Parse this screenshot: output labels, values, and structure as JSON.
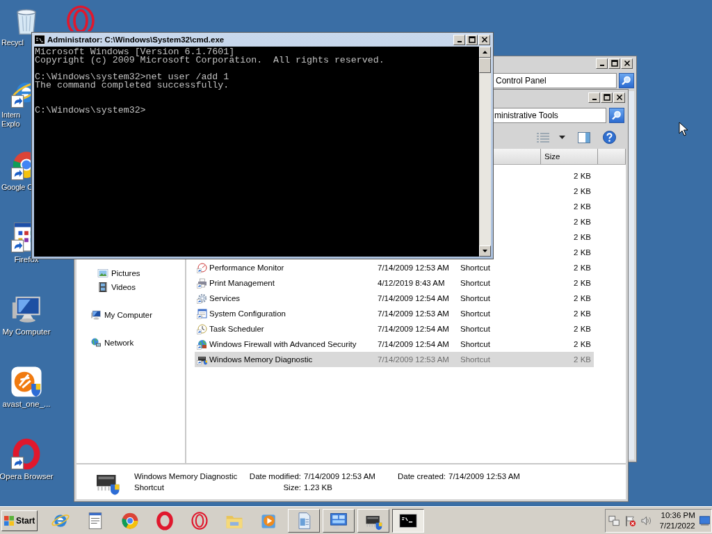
{
  "desktop": {
    "icons": [
      {
        "kind": "recycle",
        "label_lines": [
          "Recycl"
        ],
        "shortcut": false,
        "clipped": true
      },
      {
        "kind": "ie",
        "label_lines": [
          "Intern",
          "Explo"
        ],
        "shortcut": true,
        "clipped": true
      },
      {
        "kind": "chrome",
        "label_lines": [
          "Google C"
        ],
        "shortcut": true,
        "clipped": true
      },
      {
        "kind": "program",
        "label_lines": [
          "Firefox"
        ],
        "shortcut": true,
        "clipped": false
      },
      {
        "kind": "computer",
        "label_lines": [
          "My Computer"
        ],
        "shortcut": false,
        "clipped": false
      },
      {
        "kind": "avast",
        "label_lines": [
          "avast_one_..."
        ],
        "shortcut": false,
        "clipped": false
      },
      {
        "kind": "opera",
        "label_lines": [
          "Opera Browser"
        ],
        "shortcut": true,
        "clipped": false
      }
    ],
    "icon_behind_window": {
      "kind": "opera_gx"
    }
  },
  "control_panel_window": {
    "address": "Control Panel"
  },
  "explorer_window": {
    "address": "ministrative Tools",
    "columns": [
      {
        "label": "Size"
      }
    ],
    "nav": [
      {
        "label": "Pictures",
        "kind": "pictures"
      },
      {
        "label": "Videos",
        "kind": "videos"
      },
      {
        "label": "My Computer",
        "kind": "computer"
      },
      {
        "label": "Network",
        "kind": "network"
      }
    ],
    "rows": [
      {
        "size": "2 KB",
        "selected": false
      },
      {
        "size": "2 KB",
        "selected": false
      },
      {
        "size": "2 KB",
        "selected": false
      },
      {
        "size": "2 KB",
        "selected": false
      },
      {
        "size": "2 KB",
        "selected": false
      },
      {
        "size": "2 KB",
        "selected": false
      },
      {
        "kind": "perfmon",
        "name": "Performance Monitor",
        "date_modified": "7/14/2009 12:53 AM",
        "type": "Shortcut",
        "size": "2 KB",
        "selected": false
      },
      {
        "kind": "printmgmt",
        "name": "Print Management",
        "date_modified": "4/12/2019 8:43 AM",
        "type": "Shortcut",
        "size": "2 KB",
        "selected": false
      },
      {
        "kind": "services",
        "name": "Services",
        "date_modified": "7/14/2009 12:54 AM",
        "type": "Shortcut",
        "size": "2 KB",
        "selected": false
      },
      {
        "kind": "sysconfig",
        "name": "System Configuration",
        "date_modified": "7/14/2009 12:53 AM",
        "type": "Shortcut",
        "size": "2 KB",
        "selected": false
      },
      {
        "kind": "taskscheduler",
        "name": "Task Scheduler",
        "date_modified": "7/14/2009 12:54 AM",
        "type": "Shortcut",
        "size": "2 KB",
        "selected": false
      },
      {
        "kind": "firewall",
        "name": "Windows Firewall with Advanced Security",
        "date_modified": "7/14/2009 12:54 AM",
        "type": "Shortcut",
        "size": "2 KB",
        "selected": false
      },
      {
        "kind": "memdiag",
        "name": "Windows Memory Diagnostic",
        "date_modified": "7/14/2009 12:53 AM",
        "type": "Shortcut",
        "size": "2 KB",
        "selected": true
      }
    ],
    "details": {
      "name": "Windows Memory Diagnostic",
      "type": "Shortcut",
      "fields_row_1": [
        {
          "label": "Date modified:",
          "value": "7/14/2009 12:53 AM"
        },
        {
          "label": "Date created:",
          "value": "7/14/2009 12:53 AM"
        }
      ],
      "fields_row_2": [
        {
          "label": "Size:",
          "value": "1.23 KB"
        }
      ]
    }
  },
  "cmd_window": {
    "title": "Administrator: C:\\Windows\\System32\\cmd.exe",
    "output": "Microsoft Windows [Version 6.1.7601]\nCopyright (c) 2009 Microsoft Corporation.  All rights reserved.\n\nC:\\Windows\\system32>net user /add 1\nThe command completed successfully.\n\n\nC:\\Windows\\system32>"
  },
  "taskbar": {
    "start": "Start",
    "items": [
      {
        "kind": "ie",
        "running": false,
        "active": false
      },
      {
        "kind": "notepad",
        "running": false,
        "active": false
      },
      {
        "kind": "chrome",
        "running": false,
        "active": false
      },
      {
        "kind": "opera",
        "running": false,
        "active": false
      },
      {
        "kind": "opera_gx",
        "running": false,
        "active": false
      },
      {
        "kind": "folder",
        "running": false,
        "active": false
      },
      {
        "kind": "media",
        "running": false,
        "active": false
      },
      {
        "kind": "document",
        "running": true,
        "active": false
      },
      {
        "kind": "controlpanel",
        "running": true,
        "active": false
      },
      {
        "kind": "memdiag",
        "running": true,
        "active": false
      },
      {
        "kind": "cmd",
        "running": true,
        "active": true
      }
    ],
    "clock": {
      "time": "10:36 PM",
      "date": "7/21/2022"
    }
  }
}
